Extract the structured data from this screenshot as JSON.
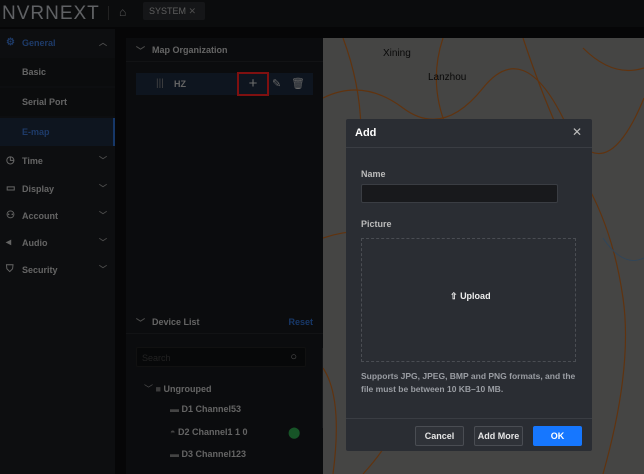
{
  "app": {
    "logo_text": "NVRNEXT",
    "home_icon": "home-icon",
    "tab": "SYSTEM"
  },
  "sidebar": {
    "items": [
      {
        "label": "General",
        "icon": "gear-icon"
      },
      {
        "label": "Basic"
      },
      {
        "label": "Serial Port"
      },
      {
        "label": "E-map"
      },
      {
        "label": "Time",
        "icon": "clock-icon"
      },
      {
        "label": "Display",
        "icon": "monitor-icon"
      },
      {
        "label": "Account",
        "icon": "user-icon"
      },
      {
        "label": "Audio",
        "icon": "speaker-icon"
      },
      {
        "label": "Security",
        "icon": "shield-icon"
      }
    ]
  },
  "map_org": {
    "title": "Map Organization",
    "node": "HZ"
  },
  "device_list": {
    "title": "Device List",
    "reset": "Reset",
    "search_placeholder": "Search",
    "group": "Ungrouped",
    "devices": [
      "D1 Channel53",
      "D2 Channel1 1 0",
      "D3 Channel123"
    ]
  },
  "map": {
    "labels": [
      "Xining",
      "Lanzhou"
    ]
  },
  "dialog": {
    "title": "Add",
    "name_label": "Name",
    "name_value": "",
    "picture_label": "Picture",
    "upload": "Upload",
    "hint": "Supports JPG, JPEG, BMP and PNG formats, and the file must be between 10 KB–10 MB.",
    "cancel": "Cancel",
    "add_more": "Add More",
    "ok": "OK"
  },
  "colors": {
    "accent": "#1677ff",
    "highlight": "#ff2020"
  }
}
